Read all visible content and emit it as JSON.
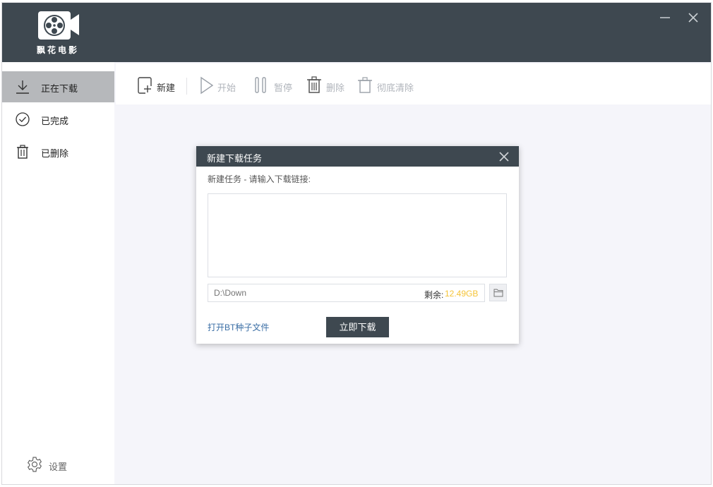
{
  "app": {
    "name": "飘花电影"
  },
  "window_controls": {
    "minimize_icon": "minimize-icon",
    "close_icon": "close-icon"
  },
  "sidebar": {
    "items": [
      {
        "label": "正在下载",
        "icon": "download-icon",
        "active": true
      },
      {
        "label": "已完成",
        "icon": "check-circle-icon",
        "active": false
      },
      {
        "label": "已删除",
        "icon": "trash-icon",
        "active": false
      }
    ],
    "settings_label": "设置"
  },
  "toolbar": {
    "new_label": "新建",
    "start_label": "开始",
    "pause_label": "暂停",
    "delete_label": "删除",
    "clear_label": "彻底清除"
  },
  "dialog": {
    "title": "新建下载任务",
    "prompt": "新建任务 - 请输入下载链接:",
    "link_value": "",
    "path_placeholder": "D:\\Down",
    "free_space_label": "剩余:",
    "free_space_value": "12.49GB",
    "bt_link_label": "打开BT种子文件",
    "download_button_label": "立即下载"
  },
  "colors": {
    "titlebar": "#3e4850",
    "sidebar_active": "#b6b8bb",
    "content_bg": "#f5f5fa",
    "free_space_value": "#f5c438",
    "link": "#3a6ea5"
  }
}
